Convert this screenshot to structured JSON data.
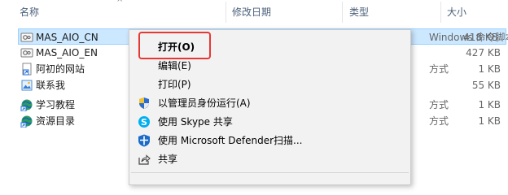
{
  "columns": {
    "name": "名称",
    "modified": "修改日期",
    "type": "类型",
    "size": "大小"
  },
  "files": [
    {
      "name": "MAS_AIO_CN",
      "type": "Windows 命令脚本",
      "size": "418 KB",
      "icon": "cmd-script-icon",
      "selected": true
    },
    {
      "name": "MAS_AIO_EN",
      "type": "",
      "size": "427 KB",
      "icon": "cmd-script-icon",
      "selected": false
    },
    {
      "name": "阿初的网站",
      "type": "方式",
      "size": "1 KB",
      "icon": "shortcut-icon",
      "selected": false
    },
    {
      "name": "联系我",
      "type": "",
      "size": "55 KB",
      "icon": "image-icon",
      "selected": false
    },
    {
      "name": "学习教程",
      "type": "方式",
      "size": "1 KB",
      "icon": "globe-shortcut-icon",
      "selected": false
    },
    {
      "name": "资源目录",
      "type": "方式",
      "size": "1 KB",
      "icon": "globe-shortcut-icon",
      "selected": false
    }
  ],
  "context_menu": {
    "open": "打开(O)",
    "edit": "编辑(E)",
    "print": "打印(P)",
    "run_as_admin": "以管理员身份运行(A)",
    "skype_share": "使用 Skype 共享",
    "defender_scan": "使用 Microsoft Defender扫描...",
    "share": "共享"
  },
  "colors": {
    "selection_bg": "#cce8ff",
    "highlight_border": "#e53935",
    "menu_bg": "#f2f2f2",
    "skype": "#00aff0",
    "defender": "#1b6ac9"
  }
}
